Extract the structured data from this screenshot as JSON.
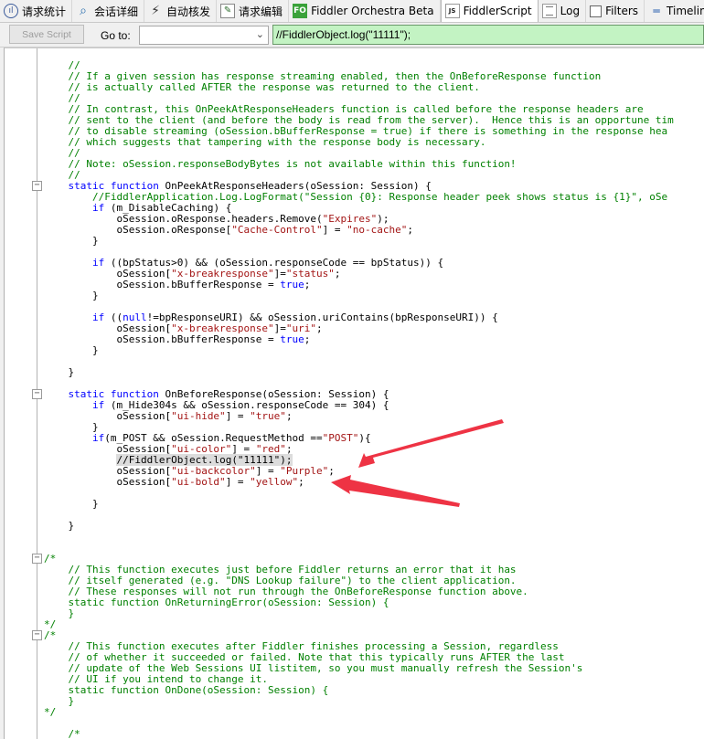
{
  "tabs": [
    {
      "label": "请求统计",
      "icon": "statistics-icon",
      "active": false
    },
    {
      "label": "会话详细",
      "icon": "inspectors-icon",
      "active": false
    },
    {
      "label": "自动核发",
      "icon": "autoresponder-icon",
      "active": false
    },
    {
      "label": "请求编辑",
      "icon": "composer-icon",
      "active": false
    },
    {
      "label": "Fiddler Orchestra Beta",
      "icon": "fiddler-orchestra-icon",
      "icon_text": "FO",
      "active": false
    },
    {
      "label": "FiddlerScript",
      "icon": "javascript-file-icon",
      "icon_text": "JS",
      "active": true
    },
    {
      "label": "Log",
      "icon": "log-icon",
      "active": false
    },
    {
      "label": "Filters",
      "icon": "filter-checkbox-icon",
      "active": false
    },
    {
      "label": "Timeline",
      "icon": "timeline-icon",
      "active": false
    }
  ],
  "toolbar": {
    "save_label": "Save Script",
    "goto_label": "Go to:",
    "goto_value": "",
    "search_value": "//FiddlerObject.log(\"11111\");"
  },
  "colors": {
    "comment": "#008000",
    "keyword": "#0000ff",
    "string": "#a31515",
    "search_bg": "#c3f3c3",
    "arrow": "#ee3344"
  },
  "code_lines": [
    [
      [
        "com",
        "    //"
      ]
    ],
    [
      [
        "com",
        "    // If a given session has response streaming enabled, then the OnBeforeResponse function"
      ]
    ],
    [
      [
        "com",
        "    // is actually called AFTER the response was returned to the client."
      ]
    ],
    [
      [
        "com",
        "    //"
      ]
    ],
    [
      [
        "com",
        "    // In contrast, this OnPeekAtResponseHeaders function is called before the response headers are"
      ]
    ],
    [
      [
        "com",
        "    // sent to the client (and before the body is read from the server).  Hence this is an opportune tim"
      ]
    ],
    [
      [
        "com",
        "    // to disable streaming (oSession.bBufferResponse = true) if there is something in the response hea"
      ]
    ],
    [
      [
        "com",
        "    // which suggests that tampering with the response body is necessary."
      ]
    ],
    [
      [
        "com",
        "    //"
      ]
    ],
    [
      [
        "com",
        "    // Note: oSession.responseBodyBytes is not available within this function!"
      ]
    ],
    [
      [
        "com",
        "    //"
      ]
    ],
    [
      [
        "kw",
        "    static function "
      ],
      [
        "txt",
        "OnPeekAtResponseHeaders(oSession: Session) {"
      ]
    ],
    [
      [
        "com",
        "        //FiddlerApplication.Log.LogFormat(\"Session {0}: Response header peek shows status is {1}\", oSe"
      ]
    ],
    [
      [
        "kw",
        "        if "
      ],
      [
        "txt",
        "(m_DisableCaching) {"
      ]
    ],
    [
      [
        "txt",
        "            oSession.oResponse.headers.Remove("
      ],
      [
        "str",
        "\"Expires\""
      ],
      [
        "txt",
        ");"
      ]
    ],
    [
      [
        "txt",
        "            oSession.oResponse["
      ],
      [
        "str",
        "\"Cache-Control\""
      ],
      [
        "txt",
        "] = "
      ],
      [
        "str",
        "\"no-cache\""
      ],
      [
        "txt",
        ";"
      ]
    ],
    [
      [
        "txt",
        "        }"
      ]
    ],
    [
      [
        "txt",
        ""
      ]
    ],
    [
      [
        "kw",
        "        if "
      ],
      [
        "txt",
        "((bpStatus>0) && (oSession.responseCode == bpStatus)) {"
      ]
    ],
    [
      [
        "txt",
        "            oSession["
      ],
      [
        "str",
        "\"x-breakresponse\""
      ],
      [
        "txt",
        "]="
      ],
      [
        "str",
        "\"status\""
      ],
      [
        "txt",
        ";"
      ]
    ],
    [
      [
        "txt",
        "            oSession.bBufferResponse = "
      ],
      [
        "kw",
        "true"
      ],
      [
        "txt",
        ";"
      ]
    ],
    [
      [
        "txt",
        "        }"
      ]
    ],
    [
      [
        "txt",
        ""
      ]
    ],
    [
      [
        "kw",
        "        if "
      ],
      [
        "txt",
        "(("
      ],
      [
        "kw",
        "null"
      ],
      [
        "txt",
        "!=bpResponseURI) && oSession.uriContains(bpResponseURI)) {"
      ]
    ],
    [
      [
        "txt",
        "            oSession["
      ],
      [
        "str",
        "\"x-breakresponse\""
      ],
      [
        "txt",
        "]="
      ],
      [
        "str",
        "\"uri\""
      ],
      [
        "txt",
        ";"
      ]
    ],
    [
      [
        "txt",
        "            oSession.bBufferResponse = "
      ],
      [
        "kw",
        "true"
      ],
      [
        "txt",
        ";"
      ]
    ],
    [
      [
        "txt",
        "        }"
      ]
    ],
    [
      [
        "txt",
        ""
      ]
    ],
    [
      [
        "txt",
        "    }"
      ]
    ],
    [
      [
        "txt",
        ""
      ]
    ],
    [
      [
        "kw",
        "    static function "
      ],
      [
        "txt",
        "OnBeforeResponse(oSession: Session) {"
      ]
    ],
    [
      [
        "kw",
        "        if "
      ],
      [
        "txt",
        "(m_Hide304s && oSession.responseCode == 304) {"
      ]
    ],
    [
      [
        "txt",
        "            oSession["
      ],
      [
        "str",
        "\"ui-hide\""
      ],
      [
        "txt",
        "] = "
      ],
      [
        "str",
        "\"true\""
      ],
      [
        "txt",
        ";"
      ]
    ],
    [
      [
        "txt",
        "        }"
      ]
    ],
    [
      [
        "kw",
        "        if"
      ],
      [
        "txt",
        "(m_POST && oSession.RequestMethod =="
      ],
      [
        "str",
        "\"POST\""
      ],
      [
        "txt",
        "){"
      ]
    ],
    [
      [
        "txt",
        "            oSession["
      ],
      [
        "str",
        "\"ui-color\""
      ],
      [
        "txt",
        "] = "
      ],
      [
        "str",
        "\"red\""
      ],
      [
        "txt",
        ";"
      ]
    ],
    [
      [
        "hl",
        "            //FiddlerObject.log(\"11111\");"
      ]
    ],
    [
      [
        "txt",
        "            oSession["
      ],
      [
        "str",
        "\"ui-backcolor\""
      ],
      [
        "txt",
        "] = "
      ],
      [
        "str",
        "\"Purple\""
      ],
      [
        "txt",
        ";"
      ]
    ],
    [
      [
        "txt",
        "            oSession["
      ],
      [
        "str",
        "\"ui-bold\""
      ],
      [
        "txt",
        "] = "
      ],
      [
        "str",
        "\"yellow\""
      ],
      [
        "txt",
        ";"
      ]
    ],
    [
      [
        "txt",
        ""
      ]
    ],
    [
      [
        "txt",
        "        }"
      ]
    ],
    [
      [
        "txt",
        ""
      ]
    ],
    [
      [
        "txt",
        "    }"
      ]
    ],
    [
      [
        "txt",
        ""
      ]
    ],
    [
      [
        "txt",
        ""
      ]
    ],
    [
      [
        "com",
        "/*"
      ]
    ],
    [
      [
        "com",
        "    // This function executes just before Fiddler returns an error that it has"
      ]
    ],
    [
      [
        "com",
        "    // itself generated (e.g. \"DNS Lookup failure\") to the client application."
      ]
    ],
    [
      [
        "com",
        "    // These responses will not run through the OnBeforeResponse function above."
      ]
    ],
    [
      [
        "com",
        "    static function OnReturningError(oSession: Session) {"
      ]
    ],
    [
      [
        "com",
        "    }"
      ]
    ],
    [
      [
        "com",
        "*/"
      ]
    ],
    [
      [
        "com",
        "/*"
      ]
    ],
    [
      [
        "com",
        "    // This function executes after Fiddler finishes processing a Session, regardless"
      ]
    ],
    [
      [
        "com",
        "    // of whether it succeeded or failed. Note that this typically runs AFTER the last"
      ]
    ],
    [
      [
        "com",
        "    // update of the Web Sessions UI listitem, so you must manually refresh the Session's"
      ]
    ],
    [
      [
        "com",
        "    // UI if you intend to change it."
      ]
    ],
    [
      [
        "com",
        "    static function OnDone(oSession: Session) {"
      ]
    ],
    [
      [
        "com",
        "    }"
      ]
    ],
    [
      [
        "com",
        "*/"
      ]
    ],
    [
      [
        "txt",
        ""
      ]
    ],
    [
      [
        "com",
        "    /*"
      ]
    ]
  ]
}
